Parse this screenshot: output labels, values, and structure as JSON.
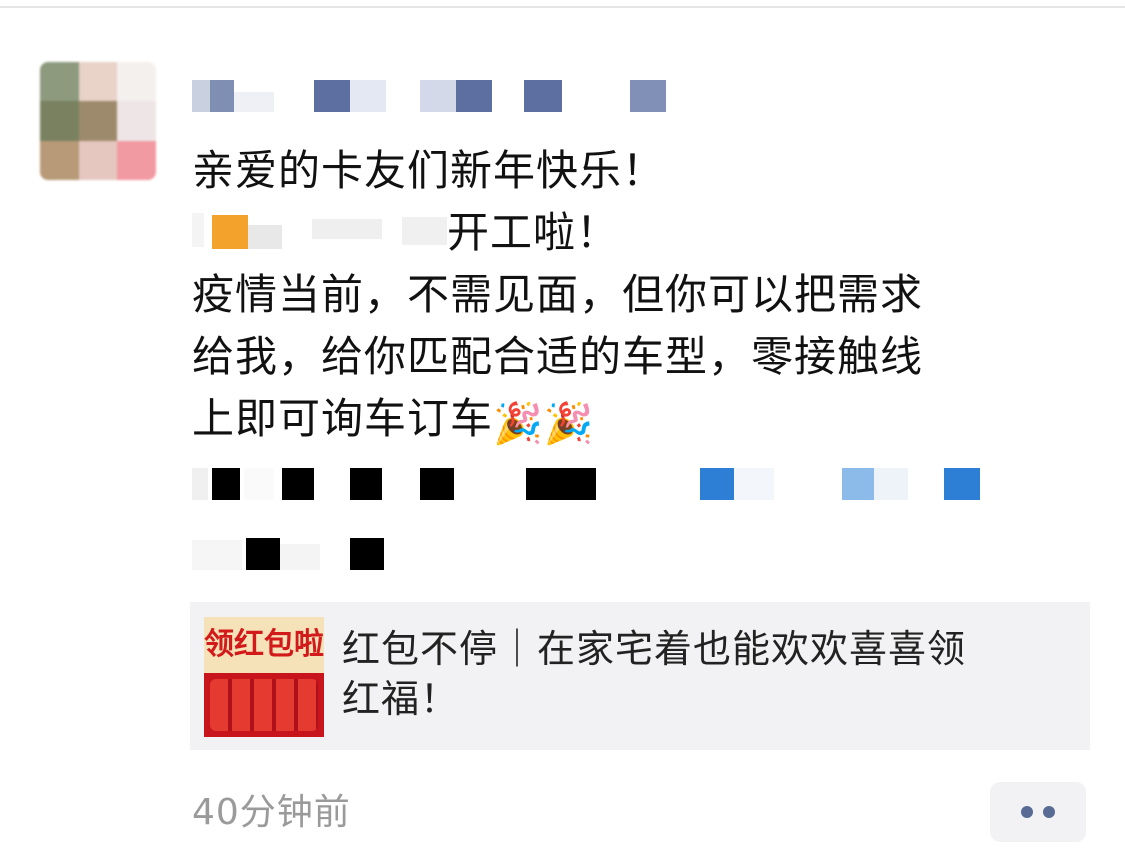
{
  "post": {
    "lines": [
      "亲爱的卡友们新年快乐！",
      "开工啦！",
      "疫情当前，不需见面，但你可以把需求",
      "给我，给你匹配合适的车型，零接触线",
      "上即可询车订车"
    ],
    "emoji": [
      "🎉",
      "🎉"
    ]
  },
  "link_card": {
    "thumb_text": "领红包啦",
    "title_line1": "红包不停｜在家宅着也能欢欢喜喜领",
    "title_line2": "红福！"
  },
  "timestamp": "40分钟前",
  "colors": {
    "link_blue": "#576b95",
    "card_bg": "#f2f2f4",
    "time_gray": "#9a9a9a"
  },
  "icons": {
    "more": "more-dots-icon",
    "party": "party-popper-icon"
  }
}
